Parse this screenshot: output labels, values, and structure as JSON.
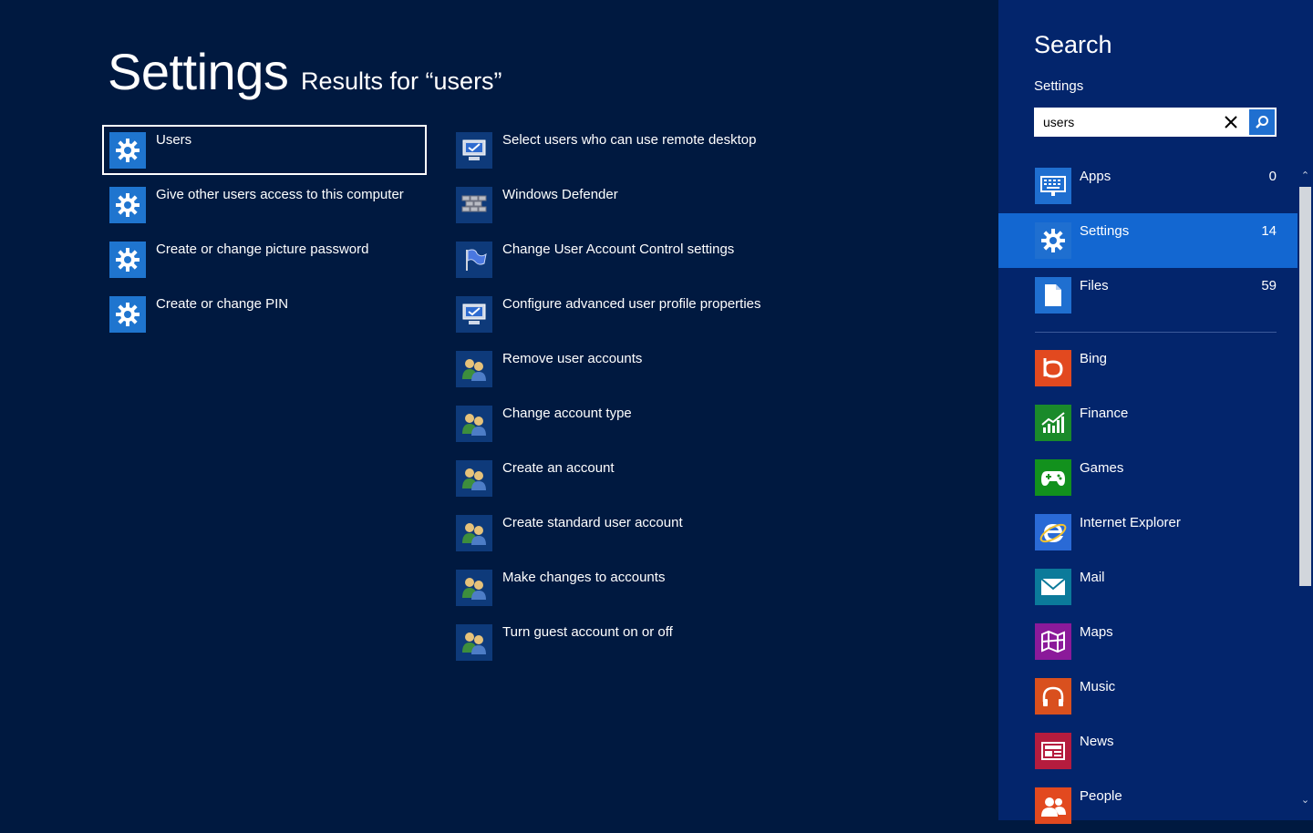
{
  "main": {
    "title": "Settings",
    "results_label": "Results for “users”",
    "left_results": [
      {
        "label": "Users",
        "icon": "gear-icon"
      },
      {
        "label": "Give other users access to this computer",
        "icon": "gear-icon"
      },
      {
        "label": "Create or change picture password",
        "icon": "gear-icon"
      },
      {
        "label": "Create or change PIN",
        "icon": "gear-icon"
      }
    ],
    "right_results": [
      {
        "label": "Select users who can use remote desktop",
        "icon": "remote-desktop-icon"
      },
      {
        "label": "Windows Defender",
        "icon": "firewall-icon"
      },
      {
        "label": "Change User Account Control settings",
        "icon": "flag-icon"
      },
      {
        "label": "Configure advanced user profile properties",
        "icon": "system-icon"
      },
      {
        "label": "Remove user accounts",
        "icon": "users-icon"
      },
      {
        "label": "Change account type",
        "icon": "users-icon"
      },
      {
        "label": "Create an account",
        "icon": "users-icon"
      },
      {
        "label": "Create standard user account",
        "icon": "users-icon"
      },
      {
        "label": "Make changes to accounts",
        "icon": "users-icon"
      },
      {
        "label": "Turn guest account on or off",
        "icon": "users-icon"
      }
    ]
  },
  "pane": {
    "title": "Search",
    "scope": "Settings",
    "search_value": "users",
    "scopes": [
      {
        "label": "Apps",
        "count": "0",
        "icon": "keyboard-icon",
        "color": "#1f6fd0"
      },
      {
        "label": "Settings",
        "count": "14",
        "icon": "gear-icon",
        "color": "#1f6fd0"
      },
      {
        "label": "Files",
        "count": "59",
        "icon": "document-icon",
        "color": "#1f6fd0"
      }
    ],
    "apps": [
      {
        "label": "Bing",
        "icon": "bing-icon",
        "color": "#e2491f"
      },
      {
        "label": "Finance",
        "icon": "chart-icon",
        "color": "#1a8a2a"
      },
      {
        "label": "Games",
        "icon": "gamepad-icon",
        "color": "#12911d"
      },
      {
        "label": "Internet Explorer",
        "icon": "ie-icon",
        "color": "#2a6ad6"
      },
      {
        "label": "Mail",
        "icon": "mail-icon",
        "color": "#0b7a9a"
      },
      {
        "label": "Maps",
        "icon": "map-icon",
        "color": "#8b1a9a"
      },
      {
        "label": "Music",
        "icon": "headphones-icon",
        "color": "#d9501e"
      },
      {
        "label": "News",
        "icon": "news-icon",
        "color": "#b51c3e"
      },
      {
        "label": "People",
        "icon": "people-icon",
        "color": "#e2491f"
      }
    ]
  }
}
